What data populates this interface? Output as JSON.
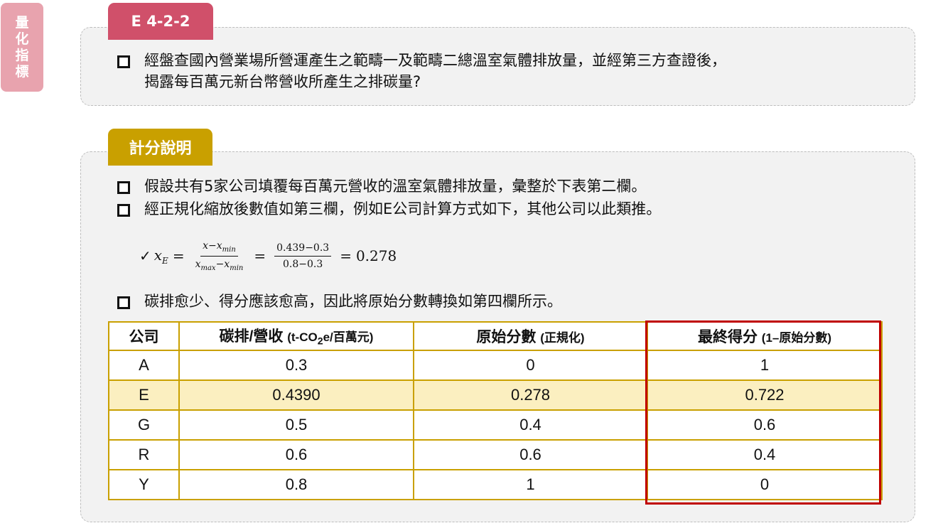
{
  "side_tab": {
    "chars": [
      "量",
      "化",
      "指",
      "標"
    ]
  },
  "section1": {
    "tag": "E 4-2-2",
    "question_line1": "經盤查國內營業場所營運產生之範疇一及範疇二總溫室氣體排放量，並經第三方查證後，",
    "question_line2": "揭露每百萬元新台幣營收所產生之排碳量?"
  },
  "section2": {
    "tag": "計分說明",
    "bullet1": "假設共有5家公司填覆每百萬元營收的溫室氣體排放量，彙整於下表第二欄。",
    "bullet2": "經正規化縮放後數值如第三欄，例如E公司計算方式如下，其他公司以此類推。",
    "bullet3": "碳排愈少、得分應該愈高，因此將原始分數轉換如第四欄所示。",
    "formula": {
      "check": "✓",
      "lhs_var": "x",
      "lhs_sub": "E",
      "eq": "=",
      "frac1_num": "x−x",
      "frac1_num_sub": "min",
      "frac1_den": "x",
      "frac1_den_sub1": "max",
      "frac1_den_mid": "−x",
      "frac1_den_sub2": "min",
      "frac2_num": "0.439−0.3",
      "frac2_den": "0.8−0.3",
      "result": "0.278"
    }
  },
  "table": {
    "headers": {
      "company": "公司",
      "emission_main": "碳排/營收",
      "emission_unit_pre": "(t-CO",
      "emission_unit_sub": "2",
      "emission_unit_post": "e/百萬元)",
      "raw_main": "原始分數",
      "raw_note": "(正規化)",
      "final_main": "最終得分",
      "final_note": "(1–原始分數)"
    },
    "rows": [
      {
        "company": "A",
        "emission": "0.3",
        "raw": "0",
        "final": "1"
      },
      {
        "company": "E",
        "emission": "0.4390",
        "raw": "0.278",
        "final": "0.722"
      },
      {
        "company": "G",
        "emission": "0.5",
        "raw": "0.4",
        "final": "0.6"
      },
      {
        "company": "R",
        "emission": "0.6",
        "raw": "0.6",
        "final": "0.4"
      },
      {
        "company": "Y",
        "emission": "0.8",
        "raw": "1",
        "final": "0"
      }
    ],
    "highlight_row": "E"
  },
  "colors": {
    "tag1": "#d0506a",
    "tag2": "#c9a000",
    "side_tab": "#e8a3ae",
    "table_border": "#c9a000",
    "highlight_row": "#fbefc0",
    "final_frame": "#c00000"
  }
}
